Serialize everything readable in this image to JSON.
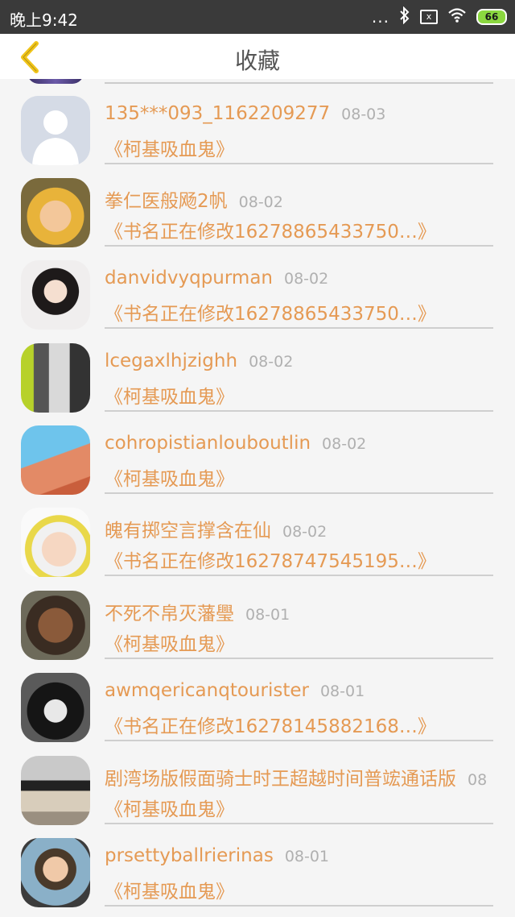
{
  "status_bar": {
    "time": "晚上9:42",
    "signal": "...",
    "sim_label": "x",
    "battery": "66",
    "icons": [
      "bluetooth-icon",
      "sim-icon",
      "wifi-icon",
      "battery-icon"
    ]
  },
  "header": {
    "title": "收藏",
    "back_icon": "chevron-left-icon"
  },
  "colors": {
    "accent": "#e59a54",
    "date": "#b0b0b0",
    "back_icon": "#f0c419"
  },
  "items": [
    {
      "name": "135***093_1162209277",
      "date": "08-03",
      "book": "《柯基吸血鬼》",
      "avatar": "default-avatar"
    },
    {
      "name": "拳仁医般飏2帆",
      "date": "08-02",
      "book": "《书名正在修改16278865433750…》",
      "avatar": "anime-avatar"
    },
    {
      "name": "danvidvyqpurman",
      "date": "08-02",
      "book": "《书名正在修改16278865433750…》",
      "avatar": "girl-avatar"
    },
    {
      "name": "lcegaxlhjzighh",
      "date": "08-02",
      "book": "《柯基吸血鬼》",
      "avatar": "boy-avatar"
    },
    {
      "name": "cohropistianlouboutlin",
      "date": "08-02",
      "book": "《柯基吸血鬼》",
      "avatar": "love-you-avatar"
    },
    {
      "name": "魄有掷空言撑含在仙",
      "date": "08-02",
      "book": "《书名正在修改16278747545195…》",
      "avatar": "cap-boy-avatar"
    },
    {
      "name": "不死不帛灭藩璺",
      "date": "08-01",
      "book": "《柯基吸血鬼》",
      "avatar": "old-man-avatar"
    },
    {
      "name": "awmqericanqtourister",
      "date": "08-01",
      "book": "《书名正在修改16278145882168…》",
      "avatar": "dark-hair-avatar"
    },
    {
      "name": "剧湾场版假面骑士时王超越时间普竤通话版",
      "date": "08",
      "book": "《柯基吸血鬼》",
      "avatar": "dog-avatar"
    },
    {
      "name": "prsettyballrierinas",
      "date": "08-01",
      "book": "《柯基吸血鬼》",
      "avatar": "guy-avatar"
    }
  ]
}
